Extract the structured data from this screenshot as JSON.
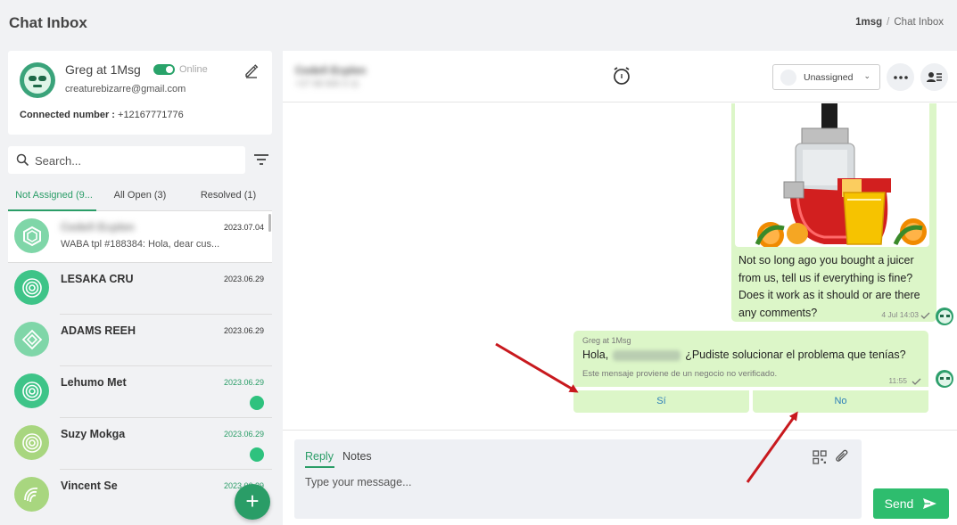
{
  "page": {
    "title": "Chat Inbox",
    "breadcrumb": [
      "1msg",
      "Chat Inbox"
    ]
  },
  "profile": {
    "name": "Greg at 1Msg",
    "status": "Online",
    "email": "creaturebizarre@gmail.com",
    "connected_label": "Connected number :",
    "connected_number": "+12167771776"
  },
  "search": {
    "placeholder": "Search..."
  },
  "tabs": [
    {
      "label": "Not Assigned (9...",
      "active": true
    },
    {
      "label": "All Open (3)",
      "active": false
    },
    {
      "label": "Resolved (1)",
      "active": false
    }
  ],
  "conversations": [
    {
      "name": "Cedeñ Ecplen",
      "blurred": true,
      "date": "2023.07.04",
      "date_green": false,
      "preview": "WABA tpl #188384: Hola, dear cus...",
      "unread": false,
      "avatar_color": "#7fd6a8",
      "icon": "hexagon-icon"
    },
    {
      "name": "LESAKA CRU",
      "blurred": false,
      "date": "2023.06.29",
      "date_green": false,
      "preview": "",
      "unread": false,
      "avatar_color": "#3ec488",
      "icon": "target-icon"
    },
    {
      "name": "ADAMS REEH",
      "blurred": false,
      "date": "2023.06.29",
      "date_green": false,
      "preview": "",
      "unread": false,
      "avatar_color": "#7fd6a8",
      "icon": "diamond-icon"
    },
    {
      "name": "Lehumo Met",
      "blurred": false,
      "date": "2023.06.29",
      "date_green": true,
      "preview": "",
      "unread": true,
      "avatar_color": "#3ec488",
      "icon": "target-icon"
    },
    {
      "name": "Suzy Mokga",
      "blurred": false,
      "date": "2023.06.29",
      "date_green": true,
      "preview": "",
      "unread": true,
      "avatar_color": "#a8d67f",
      "icon": "target-icon"
    },
    {
      "name": "Vincent Se",
      "blurred": false,
      "date": "2023.06.29",
      "date_green": true,
      "preview": "",
      "unread": false,
      "avatar_color": "#a8d67f",
      "icon": "swirl-icon"
    }
  ],
  "chat": {
    "contact_name": "Cedeñ Ecplen",
    "contact_sub": "+27 68 600 3 11",
    "assign": {
      "label": "Unassigned"
    },
    "image_message": {
      "caption": "Not so long ago you bought a juicer from us, tell us if everything is fine? Does it work as it should or are there any comments?",
      "time": "4 Jul 14:03"
    },
    "template_message": {
      "sender": "Greg at 1Msg",
      "greeting": "Hola,",
      "question": "¿Pudiste solucionar el problema que tenías?",
      "notice": "Este mensaje proviene de un negocio no verificado.",
      "time": "11:55"
    },
    "quick_replies": [
      "Sí",
      "No"
    ]
  },
  "composer": {
    "reply_tab": "Reply",
    "notes_tab": "Notes",
    "placeholder": "Type your message...",
    "send_label": "Send"
  },
  "colors": {
    "accent": "#2a9d67",
    "bubble": "#dcf6c8",
    "send": "#2ebd6e",
    "annotation_arrow": "#c8191e"
  }
}
